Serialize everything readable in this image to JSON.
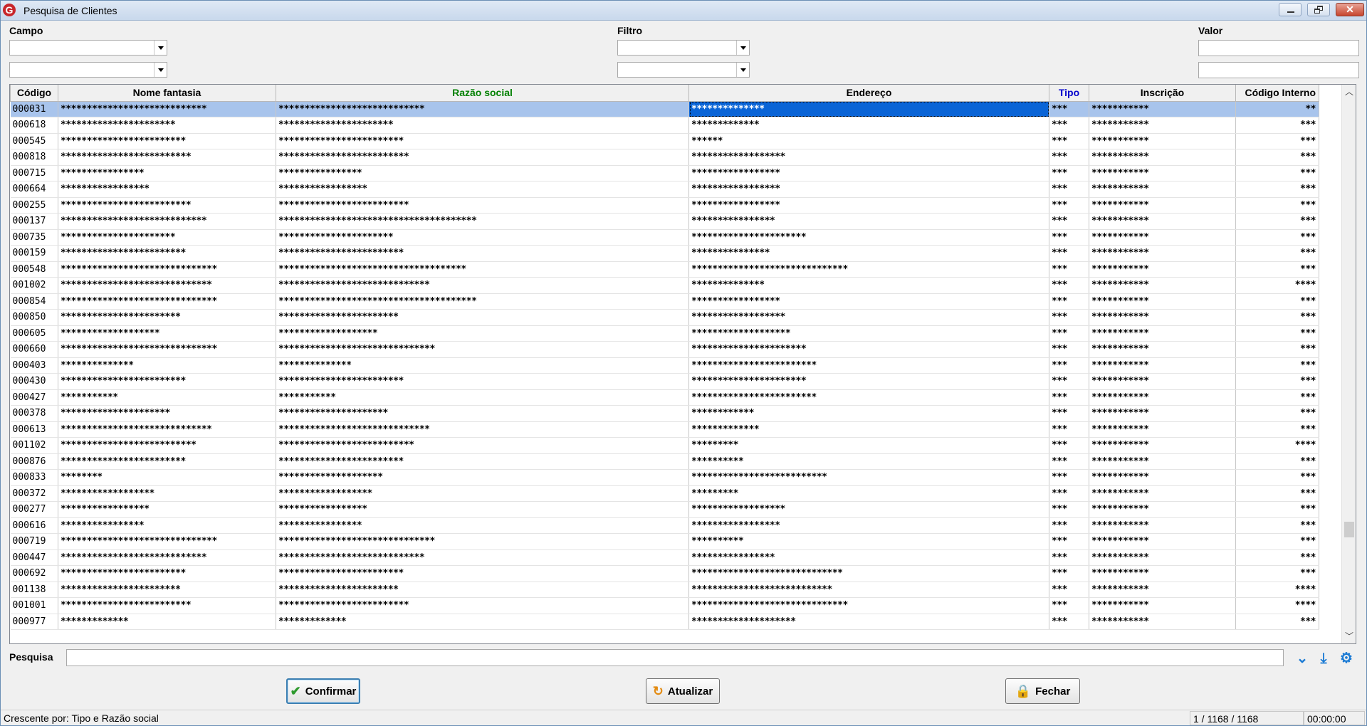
{
  "window": {
    "title": "Pesquisa de Clientes"
  },
  "filters": {
    "campo_label": "Campo",
    "filtro_label": "Filtro",
    "valor_label": "Valor",
    "campo1": "",
    "campo2": "",
    "filtro1": "",
    "filtro2": "",
    "valor1": "",
    "valor2": ""
  },
  "grid": {
    "columns": [
      "Código",
      "Nome fantasia",
      "Razão social",
      "Endereço",
      "Tipo",
      "Inscrição",
      "Código Interno"
    ],
    "column_colors": {
      "razao_social": "#008000",
      "tipo": "#0000cc"
    },
    "rows": [
      [
        "000031",
        "****************************",
        "****************************",
        "**************",
        "***",
        "***********",
        "**"
      ],
      [
        "000618",
        "**********************",
        "**********************",
        "*************",
        "***",
        "***********",
        "***"
      ],
      [
        "000545",
        "************************",
        "************************",
        "******",
        "***",
        "***********",
        "***"
      ],
      [
        "000818",
        "*************************",
        "*************************",
        "******************",
        "***",
        "***********",
        "***"
      ],
      [
        "000715",
        "****************",
        "****************",
        "*****************",
        "***",
        "***********",
        "***"
      ],
      [
        "000664",
        "*****************",
        "*****************",
        "*****************",
        "***",
        "***********",
        "***"
      ],
      [
        "000255",
        "*************************",
        "*************************",
        "*****************",
        "***",
        "***********",
        "***"
      ],
      [
        "000137",
        "****************************",
        "**************************************",
        "****************",
        "***",
        "***********",
        "***"
      ],
      [
        "000735",
        "**********************",
        "**********************",
        "**********************",
        "***",
        "***********",
        "***"
      ],
      [
        "000159",
        "************************",
        "************************",
        "***************",
        "***",
        "***********",
        "***"
      ],
      [
        "000548",
        "******************************",
        "************************************",
        "******************************",
        "***",
        "***********",
        "***"
      ],
      [
        "001002",
        "*****************************",
        "*****************************",
        "**************",
        "***",
        "***********",
        "****"
      ],
      [
        "000854",
        "******************************",
        "**************************************",
        "*****************",
        "***",
        "***********",
        "***"
      ],
      [
        "000850",
        "***********************",
        "***********************",
        "******************",
        "***",
        "***********",
        "***"
      ],
      [
        "000605",
        "*******************",
        "*******************",
        "*******************",
        "***",
        "***********",
        "***"
      ],
      [
        "000660",
        "******************************",
        "******************************",
        "**********************",
        "***",
        "***********",
        "***"
      ],
      [
        "000403",
        "**************",
        "**************",
        "************************",
        "***",
        "***********",
        "***"
      ],
      [
        "000430",
        "************************",
        "************************",
        "**********************",
        "***",
        "***********",
        "***"
      ],
      [
        "000427",
        "***********",
        "***********",
        "************************",
        "***",
        "***********",
        "***"
      ],
      [
        "000378",
        "*********************",
        "*********************",
        "************",
        "***",
        "***********",
        "***"
      ],
      [
        "000613",
        "*****************************",
        "*****************************",
        "*************",
        "***",
        "***********",
        "***"
      ],
      [
        "001102",
        "**************************",
        "**************************",
        "*********",
        "***",
        "***********",
        "****"
      ],
      [
        "000876",
        "************************",
        "************************",
        "**********",
        "***",
        "***********",
        "***"
      ],
      [
        "000833",
        "********",
        "********************",
        "**************************",
        "***",
        "***********",
        "***"
      ],
      [
        "000372",
        "******************",
        "******************",
        "*********",
        "***",
        "***********",
        "***"
      ],
      [
        "000277",
        "*****************",
        "*****************",
        "******************",
        "***",
        "***********",
        "***"
      ],
      [
        "000616",
        "****************",
        "****************",
        "*****************",
        "***",
        "***********",
        "***"
      ],
      [
        "000719",
        "******************************",
        "******************************",
        "**********",
        "***",
        "***********",
        "***"
      ],
      [
        "000447",
        "****************************",
        "****************************",
        "****************",
        "***",
        "***********",
        "***"
      ],
      [
        "000692",
        "************************",
        "************************",
        "*****************************",
        "***",
        "***********",
        "***"
      ],
      [
        "001138",
        "***********************",
        "***********************",
        "***************************",
        "***",
        "***********",
        "****"
      ],
      [
        "001001",
        "*************************",
        "*************************",
        "******************************",
        "***",
        "***********",
        "****"
      ],
      [
        "000977",
        "*************",
        "*************",
        "********************",
        "***",
        "***********",
        "***"
      ]
    ]
  },
  "search": {
    "label": "Pesquisa",
    "value": ""
  },
  "toolbar_icons": [
    "expand-down-icon",
    "expand-all-icon",
    "gear-icon"
  ],
  "buttons": {
    "confirmar": "Confirmar",
    "atualizar": "Atualizar",
    "fechar": "Fechar"
  },
  "status": {
    "sort": "Crescente por: Tipo e Razão social",
    "position": "1 / 1168 / 1168",
    "time": "00:00:00"
  },
  "colors": {
    "selection_row": "#a8c4ec",
    "focus_cell": "#0a64d6",
    "accent": "#1a7ad4"
  }
}
